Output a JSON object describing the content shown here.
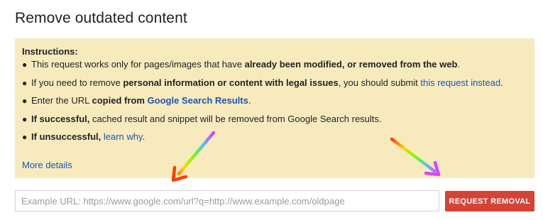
{
  "page": {
    "title": "Remove outdated content"
  },
  "instructions": {
    "heading": "Instructions:",
    "items": [
      {
        "pre": "This request works only for pages/images that have ",
        "bold": "already been modified, or removed from the web",
        "post": "."
      },
      {
        "pre": "If you need to remove ",
        "bold": "personal information or content with legal issues",
        "mid": ", you should submit ",
        "link": "this request instead",
        "post": "."
      },
      {
        "pre": "Enter the URL ",
        "bold": "copied from ",
        "link": "Google Search Results",
        "post": "."
      },
      {
        "bold": "If successful,",
        "post": " cached result and snippet will be removed from Google Search results."
      },
      {
        "bold": "If unsuccessful,",
        "mid": " ",
        "link": "learn why",
        "post": "."
      }
    ],
    "more_details": "More details"
  },
  "form": {
    "url_placeholder": "Example URL: https://www.google.com/url?q=http://www.example.com/oldpage",
    "url_value": "",
    "submit_label": "REQUEST REMOVAL"
  },
  "colors": {
    "box_background": "#f7ebbe",
    "link": "#1a55b5",
    "button": "#d34336"
  },
  "icons": {
    "annotation_arrows": "rainbow-arrow-icon"
  }
}
